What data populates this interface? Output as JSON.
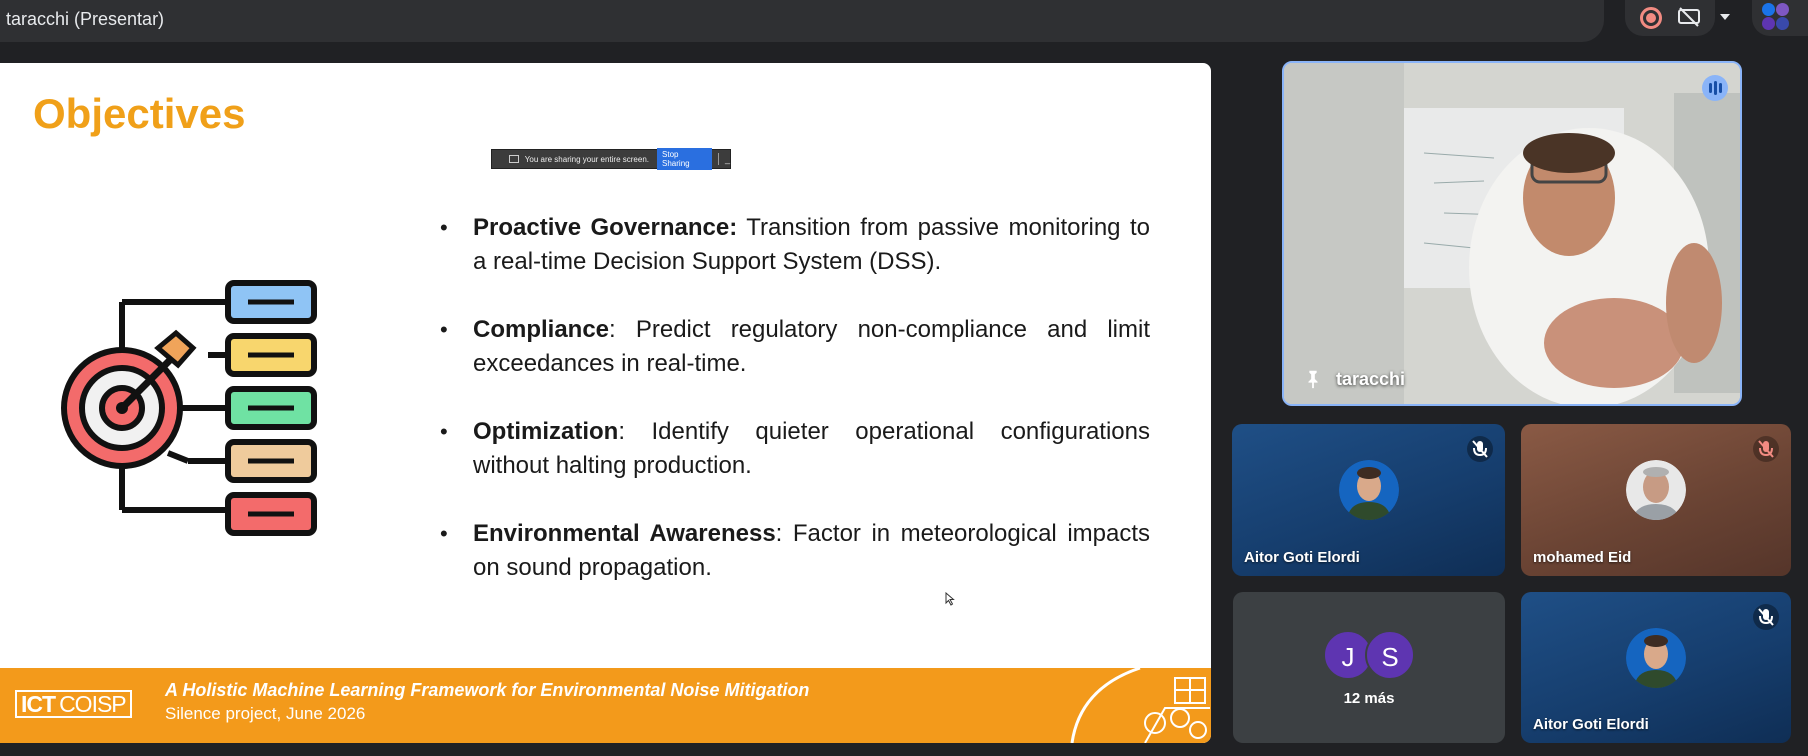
{
  "topbar": {
    "presenter_label": "taracchi (Presentar)"
  },
  "top_controls": {
    "record_icon": "record-icon",
    "share_icon": "screen-share-off-icon",
    "dropdown_icon": "chevron-down-icon"
  },
  "slide": {
    "title": "Objectives",
    "share_banner": {
      "text": "You are sharing your entire screen.",
      "stop_label": "Stop Sharing",
      "minimize_label": "_"
    },
    "bullets": [
      {
        "bold": "Proactive Governance:",
        "text": " Transition from passive monitoring to a real-time Decision Support System (DSS)."
      },
      {
        "bold": "Compliance",
        "text": ": Predict regulatory non-compliance and limit exceedances in real-time."
      },
      {
        "bold": "Optimization",
        "text": ": Identify quieter operational configurations without halting production."
      },
      {
        "bold": "Environmental Awareness",
        "text": ": Factor in meteorological impacts on sound propagation."
      }
    ],
    "footer": {
      "logo_a": "ICT",
      "logo_b": "COISP",
      "title": "A Holistic Machine Learning Framework for Environmental Noise Mitigation",
      "subtitle": "Silence project, June 2026"
    }
  },
  "participants": {
    "main": {
      "name": "taracchi"
    },
    "tile_a": {
      "name": "Aitor Goti Elordi"
    },
    "tile_b": {
      "name": "mohamed Eid"
    },
    "tile_c": {
      "initial_1": "J",
      "initial_2": "S",
      "more_label": "12 más"
    },
    "tile_d": {
      "name": "Aitor Goti Elordi"
    }
  },
  "colors": {
    "slide_title": "#f0a019",
    "footer_bg": "#f39a1b",
    "tile_highlight": "#8ab4f8",
    "avatar_purple": "#5e35b1"
  }
}
